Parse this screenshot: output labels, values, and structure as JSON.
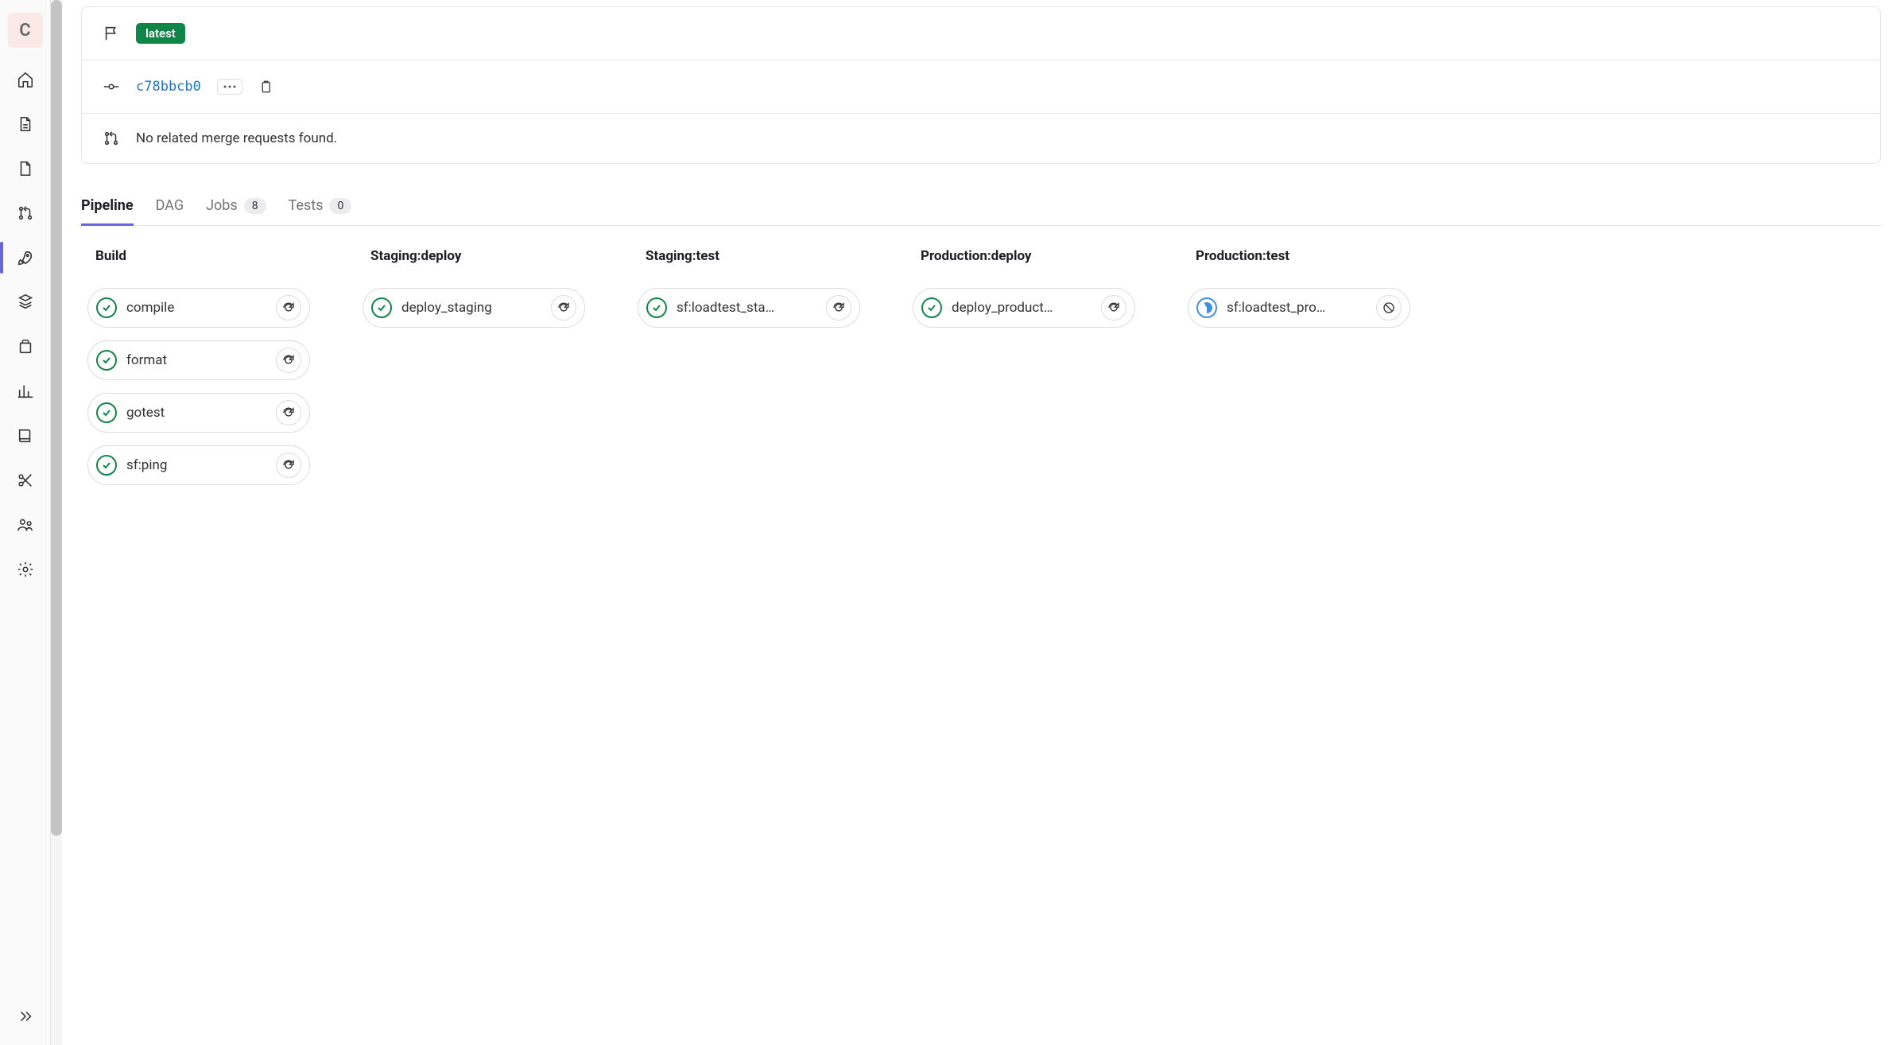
{
  "project_initial": "C",
  "sidebar": {
    "items": [
      {
        "name": "home"
      },
      {
        "name": "file"
      },
      {
        "name": "file-alt"
      },
      {
        "name": "merge-request"
      },
      {
        "name": "ci-cd",
        "active": true
      },
      {
        "name": "deployments"
      },
      {
        "name": "packages"
      },
      {
        "name": "monitor"
      },
      {
        "name": "wiki"
      },
      {
        "name": "snippets"
      },
      {
        "name": "members"
      },
      {
        "name": "settings"
      }
    ]
  },
  "pipeline_card": {
    "latest_badge": "latest",
    "commit_sha": "c78bbcb0",
    "no_mr_text": "No related merge requests found."
  },
  "tabs": [
    {
      "label": "Pipeline",
      "active": true
    },
    {
      "label": "DAG"
    },
    {
      "label": "Jobs",
      "count": "8"
    },
    {
      "label": "Tests",
      "count": "0"
    }
  ],
  "stages": [
    {
      "title": "Build",
      "jobs": [
        {
          "name": "compile",
          "status": "passed",
          "action": "retry"
        },
        {
          "name": "format",
          "status": "passed",
          "action": "retry"
        },
        {
          "name": "gotest",
          "status": "passed",
          "action": "retry"
        },
        {
          "name": "sf:ping",
          "status": "passed",
          "action": "retry"
        }
      ]
    },
    {
      "title": "Staging:deploy",
      "jobs": [
        {
          "name": "deploy_staging",
          "status": "passed",
          "action": "retry"
        }
      ]
    },
    {
      "title": "Staging:test",
      "jobs": [
        {
          "name": "sf:loadtest_sta…",
          "status": "passed",
          "action": "retry"
        }
      ]
    },
    {
      "title": "Production:deploy",
      "jobs": [
        {
          "name": "deploy_product…",
          "status": "passed",
          "action": "retry"
        }
      ]
    },
    {
      "title": "Production:test",
      "jobs": [
        {
          "name": "sf:loadtest_pro…",
          "status": "running",
          "action": "cancel"
        }
      ]
    }
  ]
}
